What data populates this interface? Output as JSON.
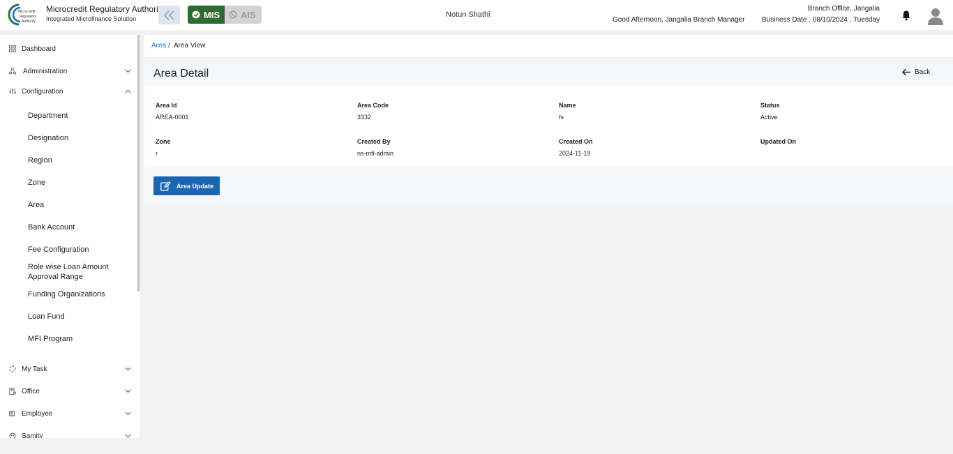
{
  "header": {
    "org_title": "Microcredit Regulatory Authority",
    "org_subtitle": "Integrated Microfinance Solution",
    "logo_text": "Microcredit Regulatory Authority",
    "mis_label": "MIS",
    "ais_label": "AIS",
    "app_name": "Notun Shathi",
    "greeting": "Good Afternoon, Jangalia Branch Manager",
    "branch": "Branch Office, Jangalia",
    "business_date": "Business Date : 08/10/2024 , Tuesday",
    "colors": {
      "mis": "#2e6b2f",
      "ais": "#d3d3d3",
      "accent": "#1a66b3"
    }
  },
  "sidebar": {
    "dashboard": "Dashboard",
    "administration": "Administration",
    "configuration": "Configuration",
    "config_items": [
      "Department",
      "Designation",
      "Region",
      "Zone",
      "Area",
      "Bank Account",
      "Fee Configuration",
      "Role wise Loan Amount Approval Range",
      "Funding Organizations",
      "Loan Fund",
      "MFI Program"
    ],
    "my_task": "My Task",
    "office": "Office",
    "employee": "Employee",
    "samity": "Samity"
  },
  "breadcrumb": {
    "parent": "Area",
    "separator": "/",
    "current": "Area View"
  },
  "detail": {
    "title": "Area Detail",
    "back_label": "Back",
    "fields": [
      {
        "label": "Area Id",
        "value": "AREA-0001"
      },
      {
        "label": "Area Code",
        "value": "3332"
      },
      {
        "label": "Name",
        "value": "fs"
      },
      {
        "label": "Status",
        "value": "Active"
      },
      {
        "label": "Zone",
        "value": "r"
      },
      {
        "label": "Created By",
        "value": "ns-mfi-admin"
      },
      {
        "label": "Created On",
        "value": "2024-11-19"
      },
      {
        "label": "Updated On",
        "value": ""
      }
    ],
    "update_label": "Area Update"
  }
}
